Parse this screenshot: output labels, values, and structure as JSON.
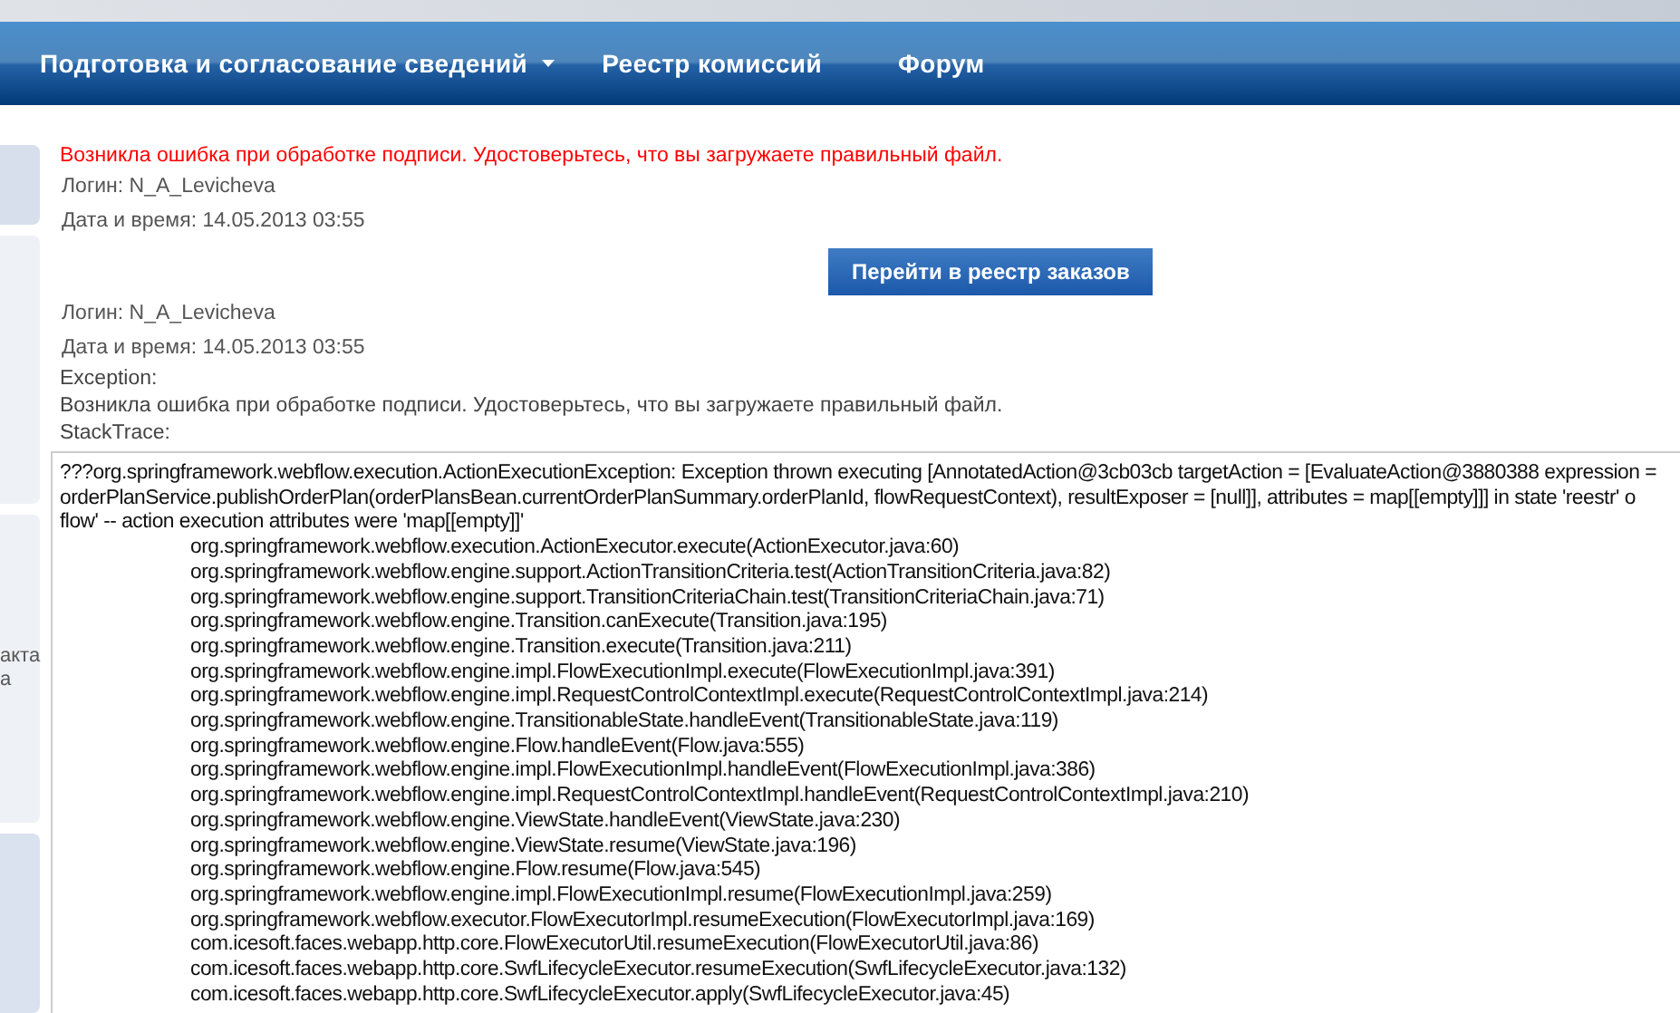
{
  "nav": {
    "items": [
      {
        "label": "Подготовка и согласование сведений",
        "has_dropdown": true
      },
      {
        "label": "Реестр комиссий",
        "has_dropdown": false
      },
      {
        "label": "Форум",
        "has_dropdown": false
      }
    ]
  },
  "sidebar": {
    "fragments": [
      "акта",
      "а"
    ]
  },
  "error_message": "Возникла ошибка при обработке подписи. Удостоверьтесь, что вы загружаете правильный файл.",
  "summary": {
    "login": "Логин: N_A_Levicheva",
    "datetime": "Дата и время: 14.05.2013 03:55"
  },
  "button": "Перейти в реестр заказов",
  "details": {
    "login": "Логин: N_A_Levicheva",
    "datetime": "Дата и время: 14.05.2013 03:55",
    "exception_label": "Exception:",
    "exception_message": "Возникла ошибка при обработке подписи. Удостоверьтесь, что вы загружаете правильный файл.",
    "stacktrace_label": "StackTrace:"
  },
  "stacktrace": {
    "message_lines": [
      "???org.springframework.webflow.execution.ActionExecutionException: Exception thrown executing [AnnotatedAction@3cb03cb targetAction = [EvaluateAction@3880388 expression =",
      "orderPlanService.publishOrderPlan(orderPlansBean.currentOrderPlanSummary.orderPlanId, flowRequestContext), resultExposer = [null]], attributes = map[[empty]]] in state 'reestr' o",
      "flow' -- action execution attributes were 'map[[empty]]'"
    ],
    "frames": [
      "org.springframework.webflow.execution.ActionExecutor.execute(ActionExecutor.java:60)",
      "org.springframework.webflow.engine.support.ActionTransitionCriteria.test(ActionTransitionCriteria.java:82)",
      "org.springframework.webflow.engine.support.TransitionCriteriaChain.test(TransitionCriteriaChain.java:71)",
      "org.springframework.webflow.engine.Transition.canExecute(Transition.java:195)",
      "org.springframework.webflow.engine.Transition.execute(Transition.java:211)",
      "org.springframework.webflow.engine.impl.FlowExecutionImpl.execute(FlowExecutionImpl.java:391)",
      "org.springframework.webflow.engine.impl.RequestControlContextImpl.execute(RequestControlContextImpl.java:214)",
      "org.springframework.webflow.engine.TransitionableState.handleEvent(TransitionableState.java:119)",
      "org.springframework.webflow.engine.Flow.handleEvent(Flow.java:555)",
      "org.springframework.webflow.engine.impl.FlowExecutionImpl.handleEvent(FlowExecutionImpl.java:386)",
      "org.springframework.webflow.engine.impl.RequestControlContextImpl.handleEvent(RequestControlContextImpl.java:210)",
      "org.springframework.webflow.engine.ViewState.handleEvent(ViewState.java:230)",
      "org.springframework.webflow.engine.ViewState.resume(ViewState.java:196)",
      "org.springframework.webflow.engine.Flow.resume(Flow.java:545)",
      "org.springframework.webflow.engine.impl.FlowExecutionImpl.resume(FlowExecutionImpl.java:259)",
      "org.springframework.webflow.executor.FlowExecutorImpl.resumeExecution(FlowExecutorImpl.java:169)",
      "com.icesoft.faces.webapp.http.core.FlowExecutorUtil.resumeExecution(FlowExecutorUtil.java:86)",
      "com.icesoft.faces.webapp.http.core.SwfLifecycleExecutor.resumeExecution(SwfLifecycleExecutor.java:132)",
      "com.icesoft.faces.webapp.http.core.SwfLifecycleExecutor.apply(SwfLifecycleExecutor.java:45)"
    ]
  }
}
